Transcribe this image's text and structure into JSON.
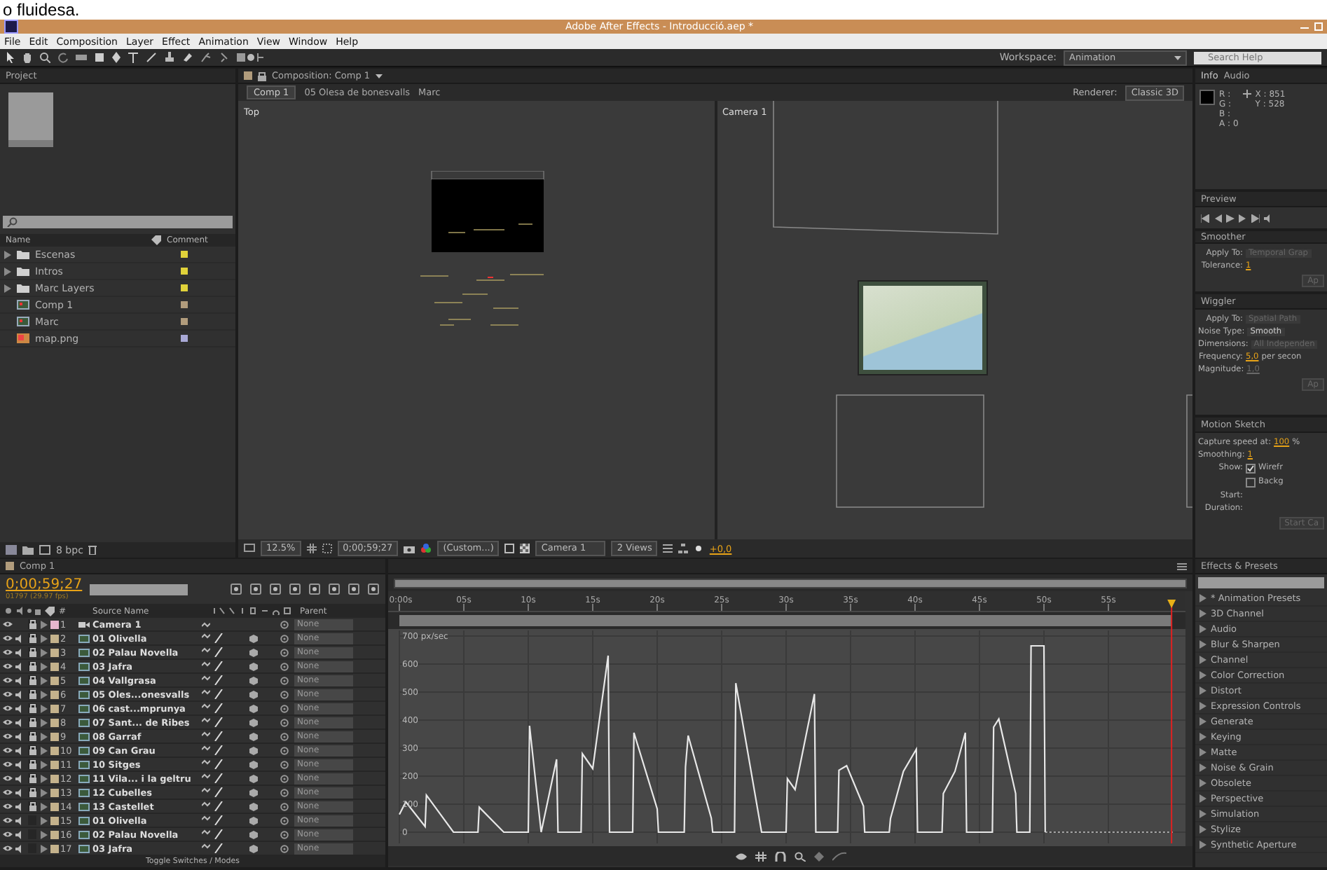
{
  "backdrop_text": "o fluidesa.",
  "window": {
    "title": "Adobe After Effects - Introducció.aep *"
  },
  "menu": [
    "File",
    "Edit",
    "Composition",
    "Layer",
    "Effect",
    "Animation",
    "View",
    "Window",
    "Help"
  ],
  "toolbar": {
    "workspace_label": "Workspace:",
    "workspace": "Animation",
    "search": {
      "placeholder": "Search Help"
    }
  },
  "project": {
    "tab": "Project",
    "columns": [
      "Name",
      "Comment"
    ],
    "items": [
      {
        "name": "Escenas",
        "kind": "folder",
        "color": "#e0d23a"
      },
      {
        "name": "Intros",
        "kind": "folder",
        "color": "#e0d23a"
      },
      {
        "name": "Marc Layers",
        "kind": "folder",
        "color": "#e0d23a"
      },
      {
        "name": "Comp 1",
        "kind": "comp",
        "color": "#b19c7c"
      },
      {
        "name": "Marc",
        "kind": "comp",
        "color": "#b19c7c"
      },
      {
        "name": "map.png",
        "kind": "image",
        "color": "#a9a9d6"
      }
    ],
    "bit_depth": "8 bpc"
  },
  "composition": {
    "tab": "Composition: Comp 1",
    "breadcrumbs": [
      "Comp 1",
      "05 Olesa de bonesvalls",
      "Marc"
    ],
    "renderer_label": "Renderer:",
    "renderer": "Classic 3D",
    "views": [
      {
        "kind": "top",
        "label": "Top"
      },
      {
        "kind": "camera",
        "label": "Camera 1"
      }
    ],
    "footer": {
      "zoom": "12.5%",
      "time": "0;00;59;27",
      "resolution": "(Custom...)",
      "camera": "Camera 1",
      "layout": "2 Views",
      "exposure": "+0,0"
    }
  },
  "info": {
    "tabs": [
      {
        "label": "Info",
        "selected": true
      },
      {
        "label": "Audio",
        "selected": false
      }
    ],
    "channels": [
      "R :",
      "G :",
      "B :",
      "A : 0"
    ],
    "coords": [
      "X : 851",
      "Y : 528"
    ]
  },
  "preview": {
    "tab": "Preview"
  },
  "panels": [
    {
      "tab": "Smoother",
      "rows": [
        {
          "kind": "dropdown",
          "label": "Apply To:",
          "value": "Temporal Grap",
          "disabled": true
        },
        {
          "kind": "scrub",
          "label": "Tolerance:",
          "value": "1",
          "disabled": false
        },
        {
          "kind": "button",
          "label": "Ap",
          "disabled": true
        }
      ]
    },
    {
      "tab": "Wiggler",
      "rows": [
        {
          "kind": "dropdown",
          "label": "Apply To:",
          "value": "Spatial Path",
          "disabled": true
        },
        {
          "kind": "dropdown",
          "label": "Noise Type:",
          "value": "Smooth",
          "disabled": false
        },
        {
          "kind": "dropdown",
          "label": "Dimensions:",
          "value": "All Independen",
          "disabled": true
        },
        {
          "kind": "scrub",
          "label": "Frequency:",
          "value": "5,0",
          "unit": "per secon",
          "disabled": false
        },
        {
          "kind": "scrub",
          "label": "Magnitude:",
          "value": "1,0",
          "disabled": true
        },
        {
          "kind": "button",
          "label": "Ap",
          "disabled": true
        }
      ]
    },
    {
      "tab": "Motion Sketch",
      "rows": [
        {
          "kind": "scrub",
          "label": "Capture speed at:",
          "value": "100",
          "unit": "%",
          "disabled": false
        },
        {
          "kind": "scrub",
          "label": "Smoothing:",
          "value": "1",
          "disabled": false
        },
        {
          "kind": "checkbox",
          "label": "Show:",
          "value": "Wirefr",
          "checked": true
        },
        {
          "kind": "checkbox",
          "value": "Backg",
          "checked": false
        },
        {
          "kind": "label",
          "label": "Start:"
        },
        {
          "kind": "label",
          "label": "Duration:"
        },
        {
          "kind": "button",
          "label": "Start Ca",
          "disabled": true
        }
      ]
    }
  ],
  "timeline": {
    "tab": "Comp 1",
    "time": "0;00;59;27",
    "frame_info": "01797 (29.97 fps)",
    "columns": [
      "#",
      "Source Name",
      "Parent"
    ],
    "layers": [
      {
        "number": "1",
        "name": "Camera 1",
        "kind": "camera",
        "color": "#e6b6cd",
        "locked": true,
        "parent": "None"
      },
      {
        "number": "2",
        "name": "01 Olivella",
        "kind": "footage",
        "color": "#c4b28c",
        "locked": true,
        "parent": "None"
      },
      {
        "number": "3",
        "name": "02 Palau Novella",
        "kind": "footage",
        "color": "#c4b28c",
        "locked": true,
        "parent": "None"
      },
      {
        "number": "4",
        "name": "03 Jafra",
        "kind": "footage",
        "color": "#c4b28c",
        "locked": true,
        "parent": "None"
      },
      {
        "number": "5",
        "name": "04 Vallgrasa",
        "kind": "footage",
        "color": "#c4b28c",
        "locked": true,
        "parent": "None"
      },
      {
        "number": "6",
        "name": "05 Oles...onesvalls",
        "kind": "footage",
        "color": "#c4b28c",
        "locked": true,
        "parent": "None"
      },
      {
        "number": "7",
        "name": "06 cast...mprunya",
        "kind": "footage",
        "color": "#c4b28c",
        "locked": true,
        "parent": "None"
      },
      {
        "number": "8",
        "name": "07 Sant... de Ribes",
        "kind": "footage",
        "color": "#c4b28c",
        "locked": true,
        "parent": "None"
      },
      {
        "number": "9",
        "name": "08 Garraf",
        "kind": "footage",
        "color": "#c4b28c",
        "locked": true,
        "parent": "None"
      },
      {
        "number": "10",
        "name": "09 Can Grau",
        "kind": "footage",
        "color": "#c4b28c",
        "locked": true,
        "parent": "None"
      },
      {
        "number": "11",
        "name": "10 Sitges",
        "kind": "footage",
        "color": "#c4b28c",
        "locked": true,
        "parent": "None"
      },
      {
        "number": "12",
        "name": "11 Vila... i la geltru",
        "kind": "footage",
        "color": "#c4b28c",
        "locked": true,
        "parent": "None"
      },
      {
        "number": "13",
        "name": "12 Cubelles",
        "kind": "footage",
        "color": "#c4b28c",
        "locked": true,
        "parent": "None"
      },
      {
        "number": "14",
        "name": "13 Castellet",
        "kind": "footage",
        "color": "#c4b28c",
        "locked": true,
        "parent": "None"
      },
      {
        "number": "15",
        "name": "01 Olivella",
        "kind": "footage",
        "color": "#c4b28c",
        "locked": false,
        "parent": "None"
      },
      {
        "number": "16",
        "name": "02 Palau Novella",
        "kind": "footage",
        "color": "#c4b28c",
        "locked": false,
        "parent": "None"
      },
      {
        "number": "17",
        "name": "03 Jafra",
        "kind": "footage",
        "color": "#c4b28c",
        "locked": false,
        "parent": "None"
      }
    ],
    "footer": "Toggle Switches / Modes",
    "graph": {
      "chart_data": {
        "type": "line",
        "xlim": [
          0,
          60
        ],
        "ylim": [
          0,
          700
        ],
        "xticks": [
          {
            "value": 0,
            "label": "0:00s"
          },
          {
            "value": 5,
            "label": "05s"
          },
          {
            "value": 10,
            "label": "10s"
          },
          {
            "value": 15,
            "label": "15s"
          },
          {
            "value": 20,
            "label": "20s"
          },
          {
            "value": 25,
            "label": "25s"
          },
          {
            "value": 30,
            "label": "30s"
          },
          {
            "value": 35,
            "label": "35s"
          },
          {
            "value": 40,
            "label": "40s"
          },
          {
            "value": 45,
            "label": "45s"
          },
          {
            "value": 50,
            "label": "50s"
          },
          {
            "value": 55,
            "label": "55s"
          }
        ],
        "yticks": [
          0,
          100,
          200,
          300,
          400,
          500,
          600,
          {
            "value": 700,
            "label": "700 px/sec"
          }
        ],
        "grid": true,
        "ref_lines": [
          {
            "axis": "x",
            "value": 59.9,
            "color": "#e02020"
          }
        ],
        "x": [
          0,
          0.5,
          2,
          2.1,
          4.2,
          6.1,
          6.2,
          8.1,
          10,
          10.1,
          11,
          12.2,
          12.3,
          14.1,
          14.2,
          15,
          16.2,
          16.3,
          18.1,
          18.2,
          20,
          20.1,
          22.1,
          22.2,
          22.4,
          24.2,
          24.3,
          26,
          26.1,
          28.1,
          30,
          30.1,
          30.7,
          32.2,
          32.3,
          34,
          34.1,
          34.7,
          36,
          36.1,
          38,
          38.1,
          39.1,
          40.1,
          40.2,
          42.1,
          42.2,
          43.1,
          43.9,
          44,
          46,
          46.1,
          46.5,
          47.8,
          47.9,
          48.9,
          49,
          50,
          50.1
        ],
        "series": [
          {
            "color": "#e8e8e8",
            "values": [
              63,
              108,
              20,
              132,
              0,
              0,
              89,
              0,
              0,
              380,
              0,
              260,
              0,
              0,
              280,
              227,
              630,
              0,
              0,
              355,
              83,
              0,
              0,
              233,
              345,
              50,
              0,
              0,
              532,
              0,
              0,
              191,
              152,
              493,
              0,
              0,
              221,
              237,
              93,
              0,
              0,
              49,
              217,
              296,
              0,
              0,
              138,
              217,
              355,
              0,
              0,
              375,
              404,
              138,
              0,
              0,
              665,
              665,
              0
            ]
          }
        ]
      }
    }
  },
  "effects": {
    "tab": "Effects & Presets",
    "items": [
      "* Animation Presets",
      "3D Channel",
      "Audio",
      "Blur & Sharpen",
      "Channel",
      "Color Correction",
      "Distort",
      "Expression Controls",
      "Generate",
      "Keying",
      "Matte",
      "Noise & Grain",
      "Obsolete",
      "Perspective",
      "Simulation",
      "Stylize",
      "Synthetic Aperture"
    ]
  }
}
